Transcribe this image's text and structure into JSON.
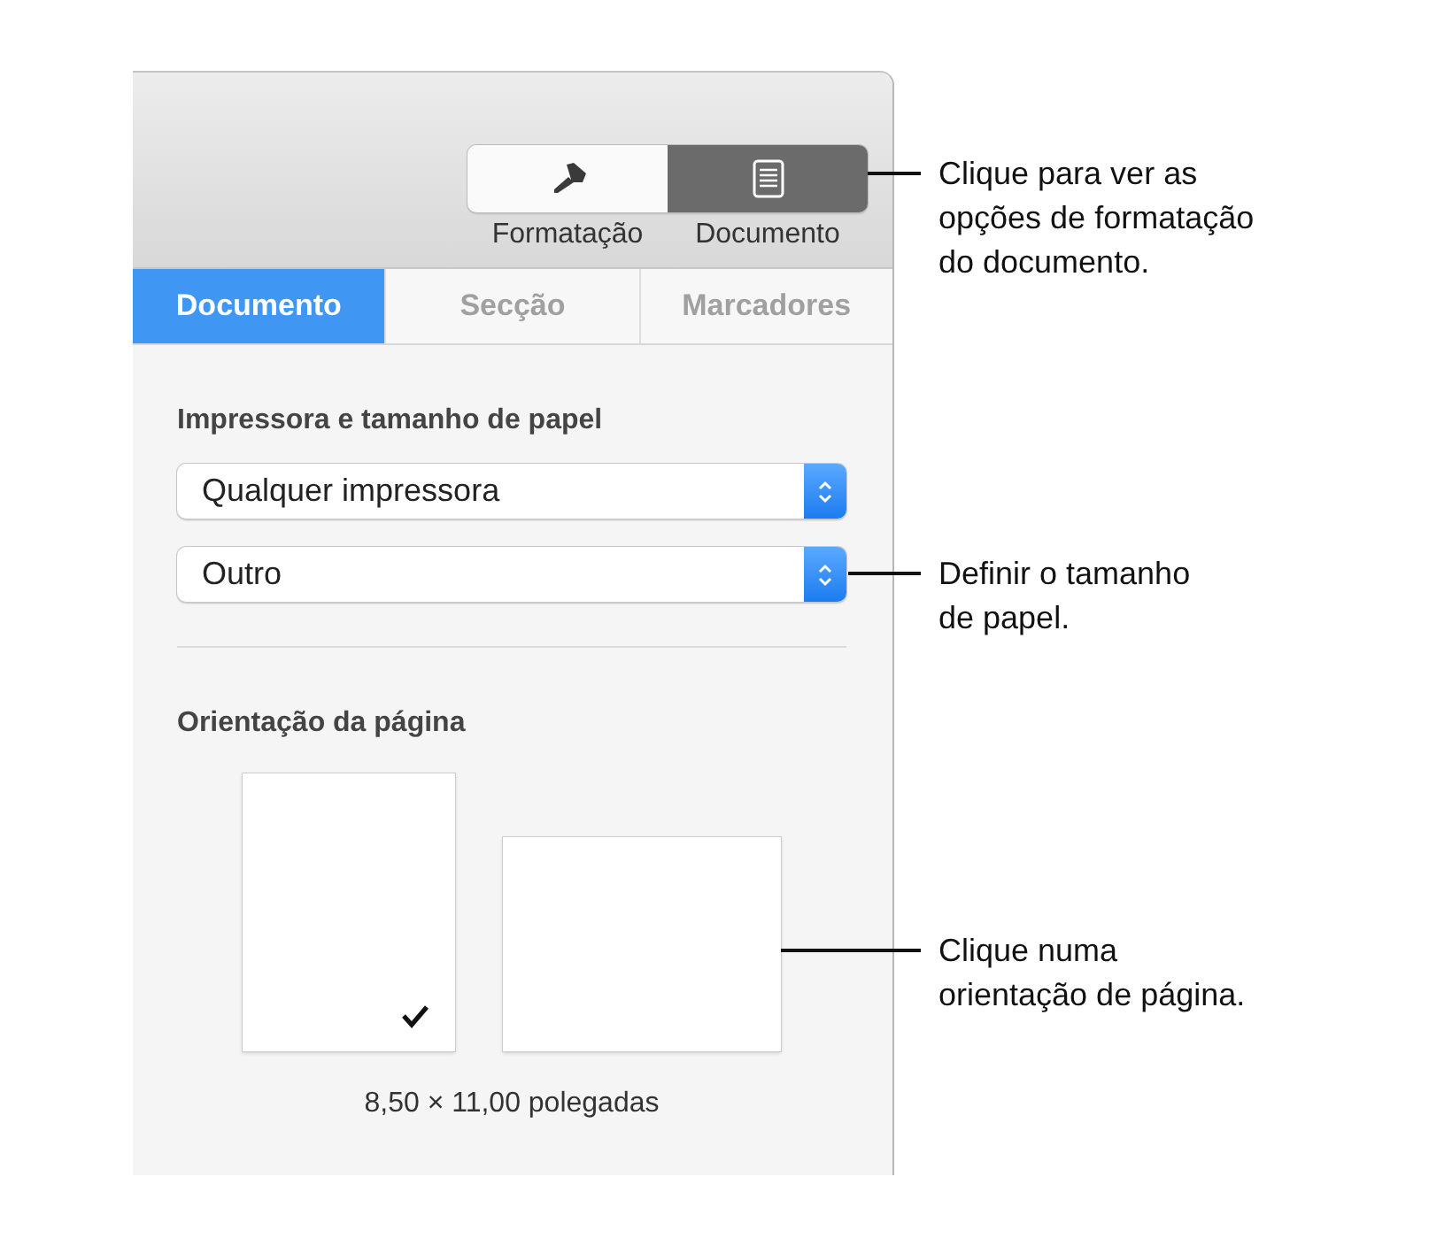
{
  "segmented_control": [
    {
      "label": "Formatação",
      "kind": "brush",
      "selected": false
    },
    {
      "label": "Documento",
      "kind": "document",
      "selected": true
    }
  ],
  "tabs": [
    {
      "label": "Documento",
      "selected": true
    },
    {
      "label": "Secção",
      "selected": false
    },
    {
      "label": "Marcadores",
      "selected": false
    }
  ],
  "printer_section": {
    "heading": "Impressora e tamanho de papel",
    "popups": [
      {
        "value": "Qualquer impressora"
      },
      {
        "value": "Outro"
      }
    ]
  },
  "orientation_section": {
    "heading": "Orientação da página",
    "options": [
      {
        "kind": "portrait",
        "selected": true
      },
      {
        "kind": "landscape",
        "selected": false
      }
    ],
    "size_caption": "8,50 × 11,00 polegadas"
  },
  "callouts": [
    {
      "text": "Clique para ver as\nopções de formatação\ndo documento."
    },
    {
      "text": "Definir o tamanho\nde papel."
    },
    {
      "text": "Clique numa\norientação de página."
    }
  ]
}
